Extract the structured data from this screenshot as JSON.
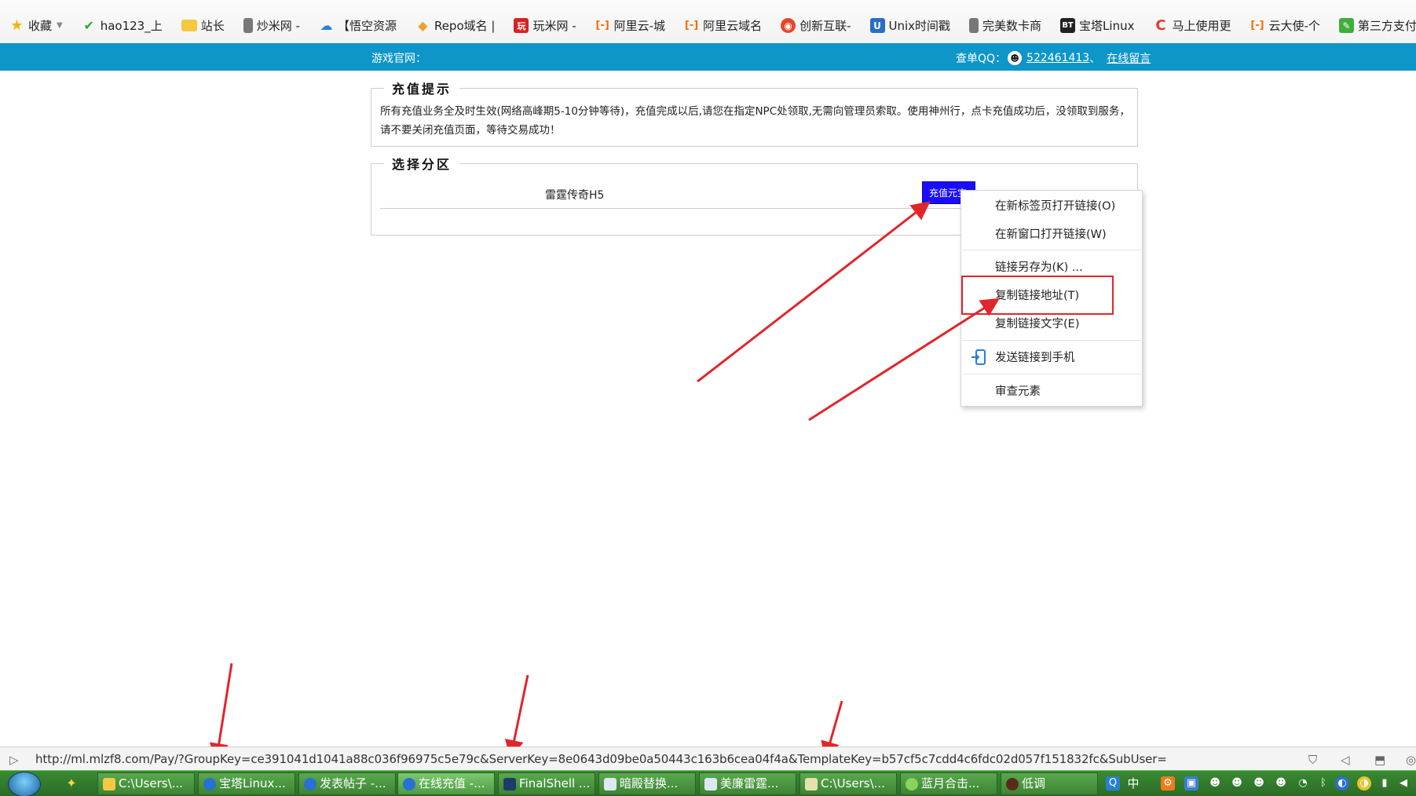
{
  "bookmarks": [
    {
      "label": "收藏",
      "icon": "star-icon"
    },
    {
      "label": "hao123_上",
      "icon": "hao123-icon"
    },
    {
      "label": "站长",
      "icon": "folder-icon"
    },
    {
      "label": "炒米网 -",
      "icon": "page-icon"
    },
    {
      "label": "【悟空资源",
      "icon": "cloud-icon"
    },
    {
      "label": "Repo域名 |",
      "icon": "repo-icon"
    },
    {
      "label": "玩米网 -",
      "icon": "wanmi-icon"
    },
    {
      "label": "阿里云-城",
      "icon": "aliyun-icon"
    },
    {
      "label": "阿里云域名",
      "icon": "aliyun-icon"
    },
    {
      "label": "创新互联-",
      "icon": "flame-icon"
    },
    {
      "label": "Unix时间戳",
      "icon": "unix-icon"
    },
    {
      "label": "完美数卡商",
      "icon": "page-icon"
    },
    {
      "label": "宝塔Linux",
      "icon": "bt-icon"
    },
    {
      "label": "马上使用更",
      "icon": "c-icon"
    },
    {
      "label": "云大使-个",
      "icon": "aliyun-icon"
    },
    {
      "label": "第三方支付",
      "icon": "pen-icon"
    }
  ],
  "header": {
    "game_site_label": "游戏官网：",
    "qq_label": "查单QQ：",
    "qq_number": "522461413",
    "separator": "、",
    "message_link": "在线留言"
  },
  "tip_box": {
    "legend": "充值提示",
    "text": "所有充值业务全及时生效(网络高峰期5-10分钟等待)，充值完成以后,请您在指定NPC处领取,无需向管理员索取。使用神州行，点卡充值成功后，没领取到服务，请不要关闭充值页面，等待交易成功！"
  },
  "zone_box": {
    "legend": "选择分区",
    "zone_name": "雷霆传奇H5",
    "recharge_button": "充值元宝"
  },
  "context_menu": {
    "items": [
      "在新标签页打开链接(O)",
      "在新窗口打开链接(W)",
      "链接另存为(K) ...",
      "复制链接地址(T)",
      "复制链接文字(E)",
      "发送链接到手机",
      "审查元素"
    ]
  },
  "status_bar": {
    "url": "http://ml.mlzf8.com/Pay/?GroupKey=ce391041d1041a88c036f96975c5e79c&ServerKey=8e0643d09be0a50443c163b6cea04f4a&TemplateKey=b57cf5c7cdd4c6fdc02d057f151832fc&SubUser="
  },
  "taskbar": {
    "items": [
      "C:\\Users\\...",
      "宝塔Linux...",
      "发表帖子 -...",
      "在线充值 -...",
      "FinalShell ...",
      "暗殿替换...",
      "美廉雷霆...",
      "C:\\Users\\...",
      "蓝月合击...",
      "低调"
    ],
    "ime": "中"
  },
  "colors": {
    "header_bg": "#0e96c8",
    "button_bg": "#1a0dff",
    "annotation_red": "#e0262b",
    "taskbar_green": "#3a8a33"
  }
}
